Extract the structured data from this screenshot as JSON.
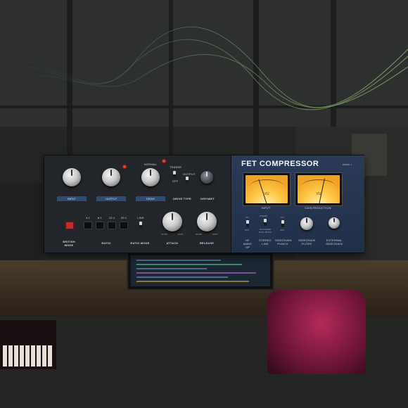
{
  "plugin": {
    "title": "FET COMPRESSOR",
    "model": "MODEL 1",
    "left": {
      "sections": [
        "INPUT",
        "OUTPUT",
        "DRIVE"
      ],
      "drive_type": "DRIVE TYPE",
      "drive_type_opts": [
        "TRANSE",
        "OUTPUT",
        "OFF"
      ],
      "normal": "NORMAL",
      "drywet": "DRY/WET",
      "british_mode": "BRITISH MODE",
      "ratio": "RATIO",
      "ratio_values": [
        "4:1",
        "8:1",
        "12:1",
        "20:1"
      ],
      "ratio_mode": "RATIO MODE",
      "attack": "ATTACK",
      "release": "RELEASE",
      "slow": "SLOW",
      "fast": "FAST",
      "link": "LINK"
    },
    "right": {
      "input": "INPUT",
      "gain_reduction": "GAIN REDUCTION",
      "vu": "VU",
      "buttons": [
        "HF MAKE UP",
        "STEREO LINK",
        "SIDECHAIN PUNCH",
        "SIDECHAIN FILTER",
        "EXTERNAL SIDECHAIN"
      ],
      "on": "ON",
      "off": "OFF",
      "linked": "LINKED",
      "balanced": "BALANCED DUAL MONO"
    }
  },
  "colors": {
    "accent": "#2f4a73",
    "vu_face": "#ffc94a",
    "led": "#ff3b2f",
    "chair": "#b42a5a"
  }
}
